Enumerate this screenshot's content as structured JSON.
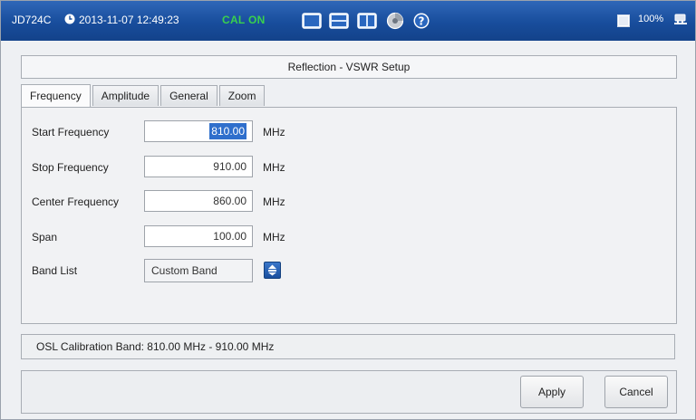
{
  "status_bar": {
    "model": "JD724C",
    "datetime": "2013-11-07 12:49:23",
    "cal_status": "CAL ON",
    "battery": "100%",
    "toolbar_icons": [
      "single-view-icon",
      "dual-view-icon",
      "split-view-icon",
      "settings-disc-icon",
      "help-icon"
    ]
  },
  "dialog": {
    "title": "Reflection - VSWR Setup",
    "tabs": [
      {
        "label": "Frequency",
        "active": true
      },
      {
        "label": "Amplitude",
        "active": false
      },
      {
        "label": "General",
        "active": false
      },
      {
        "label": "Zoom",
        "active": false
      }
    ],
    "fields": {
      "start": {
        "label": "Start Frequency",
        "value": "810.00",
        "unit": "MHz"
      },
      "stop": {
        "label": "Stop Frequency",
        "value": "910.00",
        "unit": "MHz"
      },
      "center": {
        "label": "Center Frequency",
        "value": "860.00",
        "unit": "MHz"
      },
      "span": {
        "label": "Span",
        "value": "100.00",
        "unit": "MHz"
      },
      "band_list": {
        "label": "Band List",
        "value": "Custom Band"
      }
    },
    "info": "OSL Calibration Band: 810.00 MHz - 910.00 MHz",
    "buttons": {
      "apply": "Apply",
      "cancel": "Cancel"
    }
  },
  "colors": {
    "status_bar": "#1b4f9e",
    "cal_on": "#39d14d",
    "selection": "#2f6fcc"
  }
}
